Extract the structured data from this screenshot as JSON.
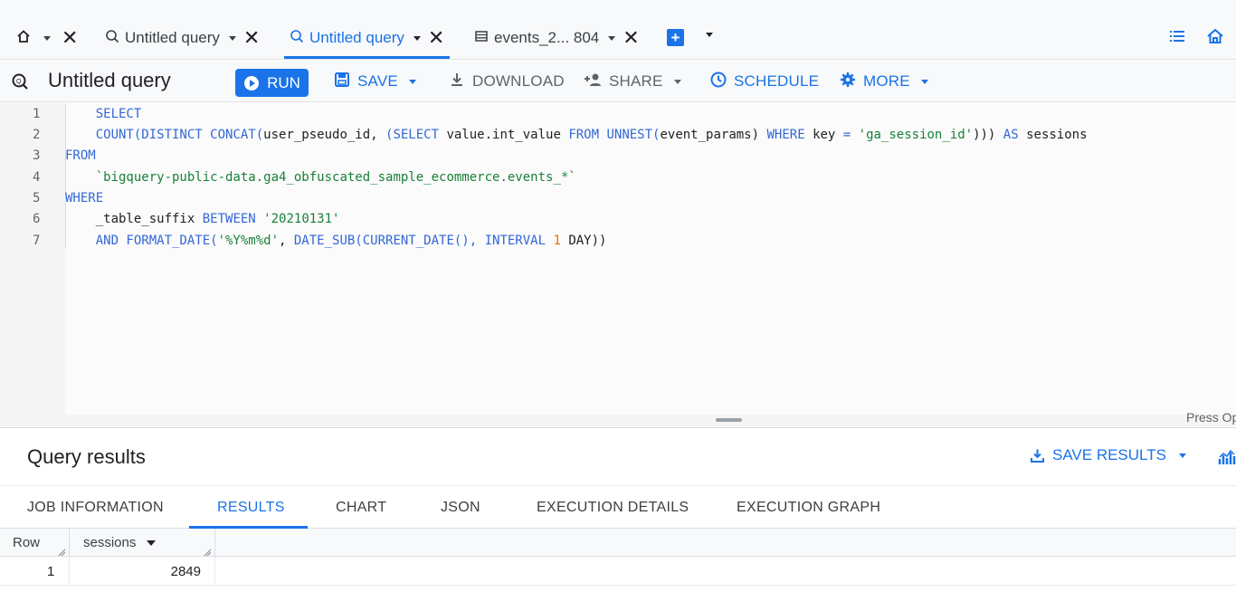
{
  "tabs": {
    "items": [
      {
        "label": "Untitled query"
      },
      {
        "label": "Untitled query"
      },
      {
        "label": "events_2... 804"
      }
    ]
  },
  "toolbar": {
    "query_title": "Untitled query",
    "run_label": "RUN",
    "save_label": "SAVE",
    "download_label": "DOWNLOAD",
    "share_label": "SHARE",
    "schedule_label": "SCHEDULE",
    "more_label": "MORE"
  },
  "editor": {
    "line_numbers": [
      "1",
      "2",
      "3",
      "4",
      "5",
      "6",
      "7"
    ],
    "lines": [
      {
        "indent": "    ",
        "segments": [
          {
            "t": "SELECT",
            "c": "kw"
          }
        ]
      },
      {
        "indent": "    ",
        "segments": [
          {
            "t": "COUNT(DISTINCT CONCAT(",
            "c": "kw"
          },
          {
            "t": "user_pseudo_id, ",
            "c": ""
          },
          {
            "t": "(SELECT ",
            "c": "kw"
          },
          {
            "t": "value.int_value ",
            "c": ""
          },
          {
            "t": "FROM UNNEST(",
            "c": "kw"
          },
          {
            "t": "event_params) ",
            "c": ""
          },
          {
            "t": "WHERE ",
            "c": "kw"
          },
          {
            "t": "key ",
            "c": ""
          },
          {
            "t": "= ",
            "c": "kw"
          },
          {
            "t": "'ga_session_id'",
            "c": "str"
          },
          {
            "t": "))) ",
            "c": ""
          },
          {
            "t": "AS ",
            "c": "kw"
          },
          {
            "t": "sessions",
            "c": ""
          }
        ]
      },
      {
        "indent": "",
        "segments": [
          {
            "t": "FROM",
            "c": "kw"
          }
        ]
      },
      {
        "indent": "    ",
        "segments": [
          {
            "t": "`bigquery-public-data.ga4_obfuscated_sample_ecommerce.events_*`",
            "c": "str"
          }
        ]
      },
      {
        "indent": "",
        "segments": [
          {
            "t": "WHERE",
            "c": "kw"
          }
        ]
      },
      {
        "indent": "    ",
        "segments": [
          {
            "t": "_table_suffix ",
            "c": ""
          },
          {
            "t": "BETWEEN ",
            "c": "kw"
          },
          {
            "t": "'20210131'",
            "c": "str"
          }
        ]
      },
      {
        "indent": "    ",
        "segments": [
          {
            "t": "AND FORMAT_DATE(",
            "c": "kw"
          },
          {
            "t": "'%Y%m%d'",
            "c": "str"
          },
          {
            "t": ", ",
            "c": ""
          },
          {
            "t": "DATE_SUB(CURRENT_DATE(), INTERVAL ",
            "c": "kw"
          },
          {
            "t": "1 ",
            "c": "num"
          },
          {
            "t": "DAY))",
            "c": ""
          }
        ]
      }
    ],
    "press_hint": "Press Op"
  },
  "results": {
    "title": "Query results",
    "save_results_label": "SAVE RESULTS",
    "tabs": [
      "JOB INFORMATION",
      "RESULTS",
      "CHART",
      "JSON",
      "EXECUTION DETAILS",
      "EXECUTION GRAPH"
    ],
    "columns": [
      "Row",
      "sessions"
    ],
    "rows": [
      [
        "1",
        "2849"
      ]
    ]
  },
  "colors": {
    "accent": "#1a73e8",
    "keyword": "#3367d6",
    "string": "#188038",
    "number": "#e37400"
  }
}
